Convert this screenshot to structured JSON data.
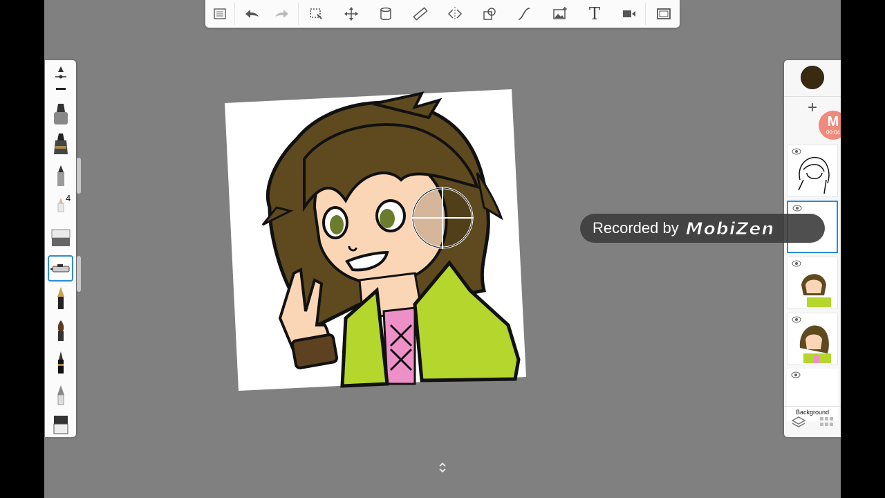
{
  "toolbar": {
    "items": [
      {
        "name": "menu-list-icon"
      },
      {
        "name": "undo-icon"
      },
      {
        "name": "redo-icon"
      },
      {
        "name": "selection-icon"
      },
      {
        "name": "transform-icon"
      },
      {
        "name": "fill-bucket-icon"
      },
      {
        "name": "ruler-icon"
      },
      {
        "name": "symmetry-icon"
      },
      {
        "name": "shapes-icon"
      },
      {
        "name": "curve-icon"
      },
      {
        "name": "add-image-icon"
      },
      {
        "name": "text-tool-icon",
        "glyph": "T"
      },
      {
        "name": "time-lapse-icon"
      },
      {
        "name": "fullscreen-icon"
      }
    ]
  },
  "brushes": {
    "selected_size": "4",
    "items": [
      "brush-properties-icon",
      "marker-icon",
      "airbrush-icon",
      "pencil-icon",
      "small-brush-icon",
      "eraser-icon",
      "ink-pen-icon",
      "fountain-pen-icon",
      "paint-brush-icon",
      "calligraphy-brush-icon",
      "smudge-icon",
      "pattern-brush-icon"
    ]
  },
  "layers": {
    "current_color": "#3a2a10",
    "add_label": "+",
    "items": [
      {
        "name": "layer-lineart",
        "label": ""
      },
      {
        "name": "layer-empty-active",
        "label": ""
      },
      {
        "name": "layer-shading",
        "label": ""
      },
      {
        "name": "layer-color",
        "label": ""
      },
      {
        "name": "layer-background",
        "label": "Background"
      }
    ]
  },
  "recording": {
    "text": "Recorded by",
    "brand": "MobiZen",
    "bubble_letter": "M",
    "bubble_time": "00:04"
  },
  "colors": {
    "accent": "#2b8cd9",
    "hair": "#5e4a1e",
    "jacket": "#b5d62d",
    "shirt": "#ee90c8",
    "skin": "#fbd6b6"
  }
}
